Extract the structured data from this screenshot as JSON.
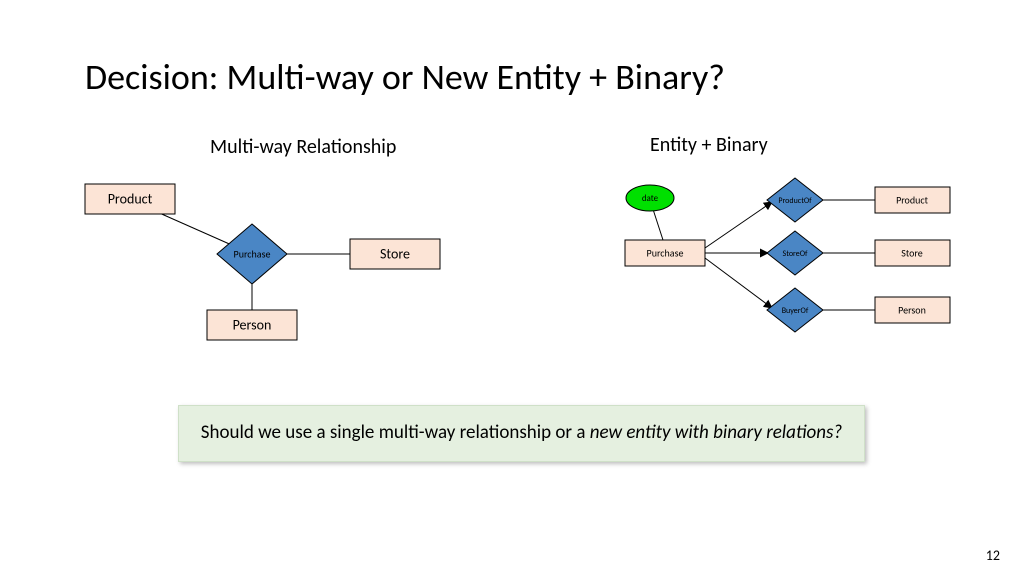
{
  "title": "Decision: Multi-way or New Entity + Binary?",
  "left": {
    "heading": "Multi-way Relationship",
    "entities": {
      "product": "Product",
      "store": "Store",
      "person": "Person"
    },
    "relationship": "Purchase"
  },
  "right": {
    "heading": "Entity + Binary",
    "centerEntity": "Purchase",
    "attribute": "date",
    "rels": {
      "productOf": "ProductOf",
      "storeOf": "StoreOf",
      "buyerOf": "BuyerOf"
    },
    "entities": {
      "product": "Product",
      "store": "Store",
      "person": "Person"
    }
  },
  "question": {
    "prefix": "Should we use a single ",
    "boldA": "multi-way relationship",
    "mid": " or a ",
    "italB": "new entity with binary relations?"
  },
  "pageNumber": "12"
}
